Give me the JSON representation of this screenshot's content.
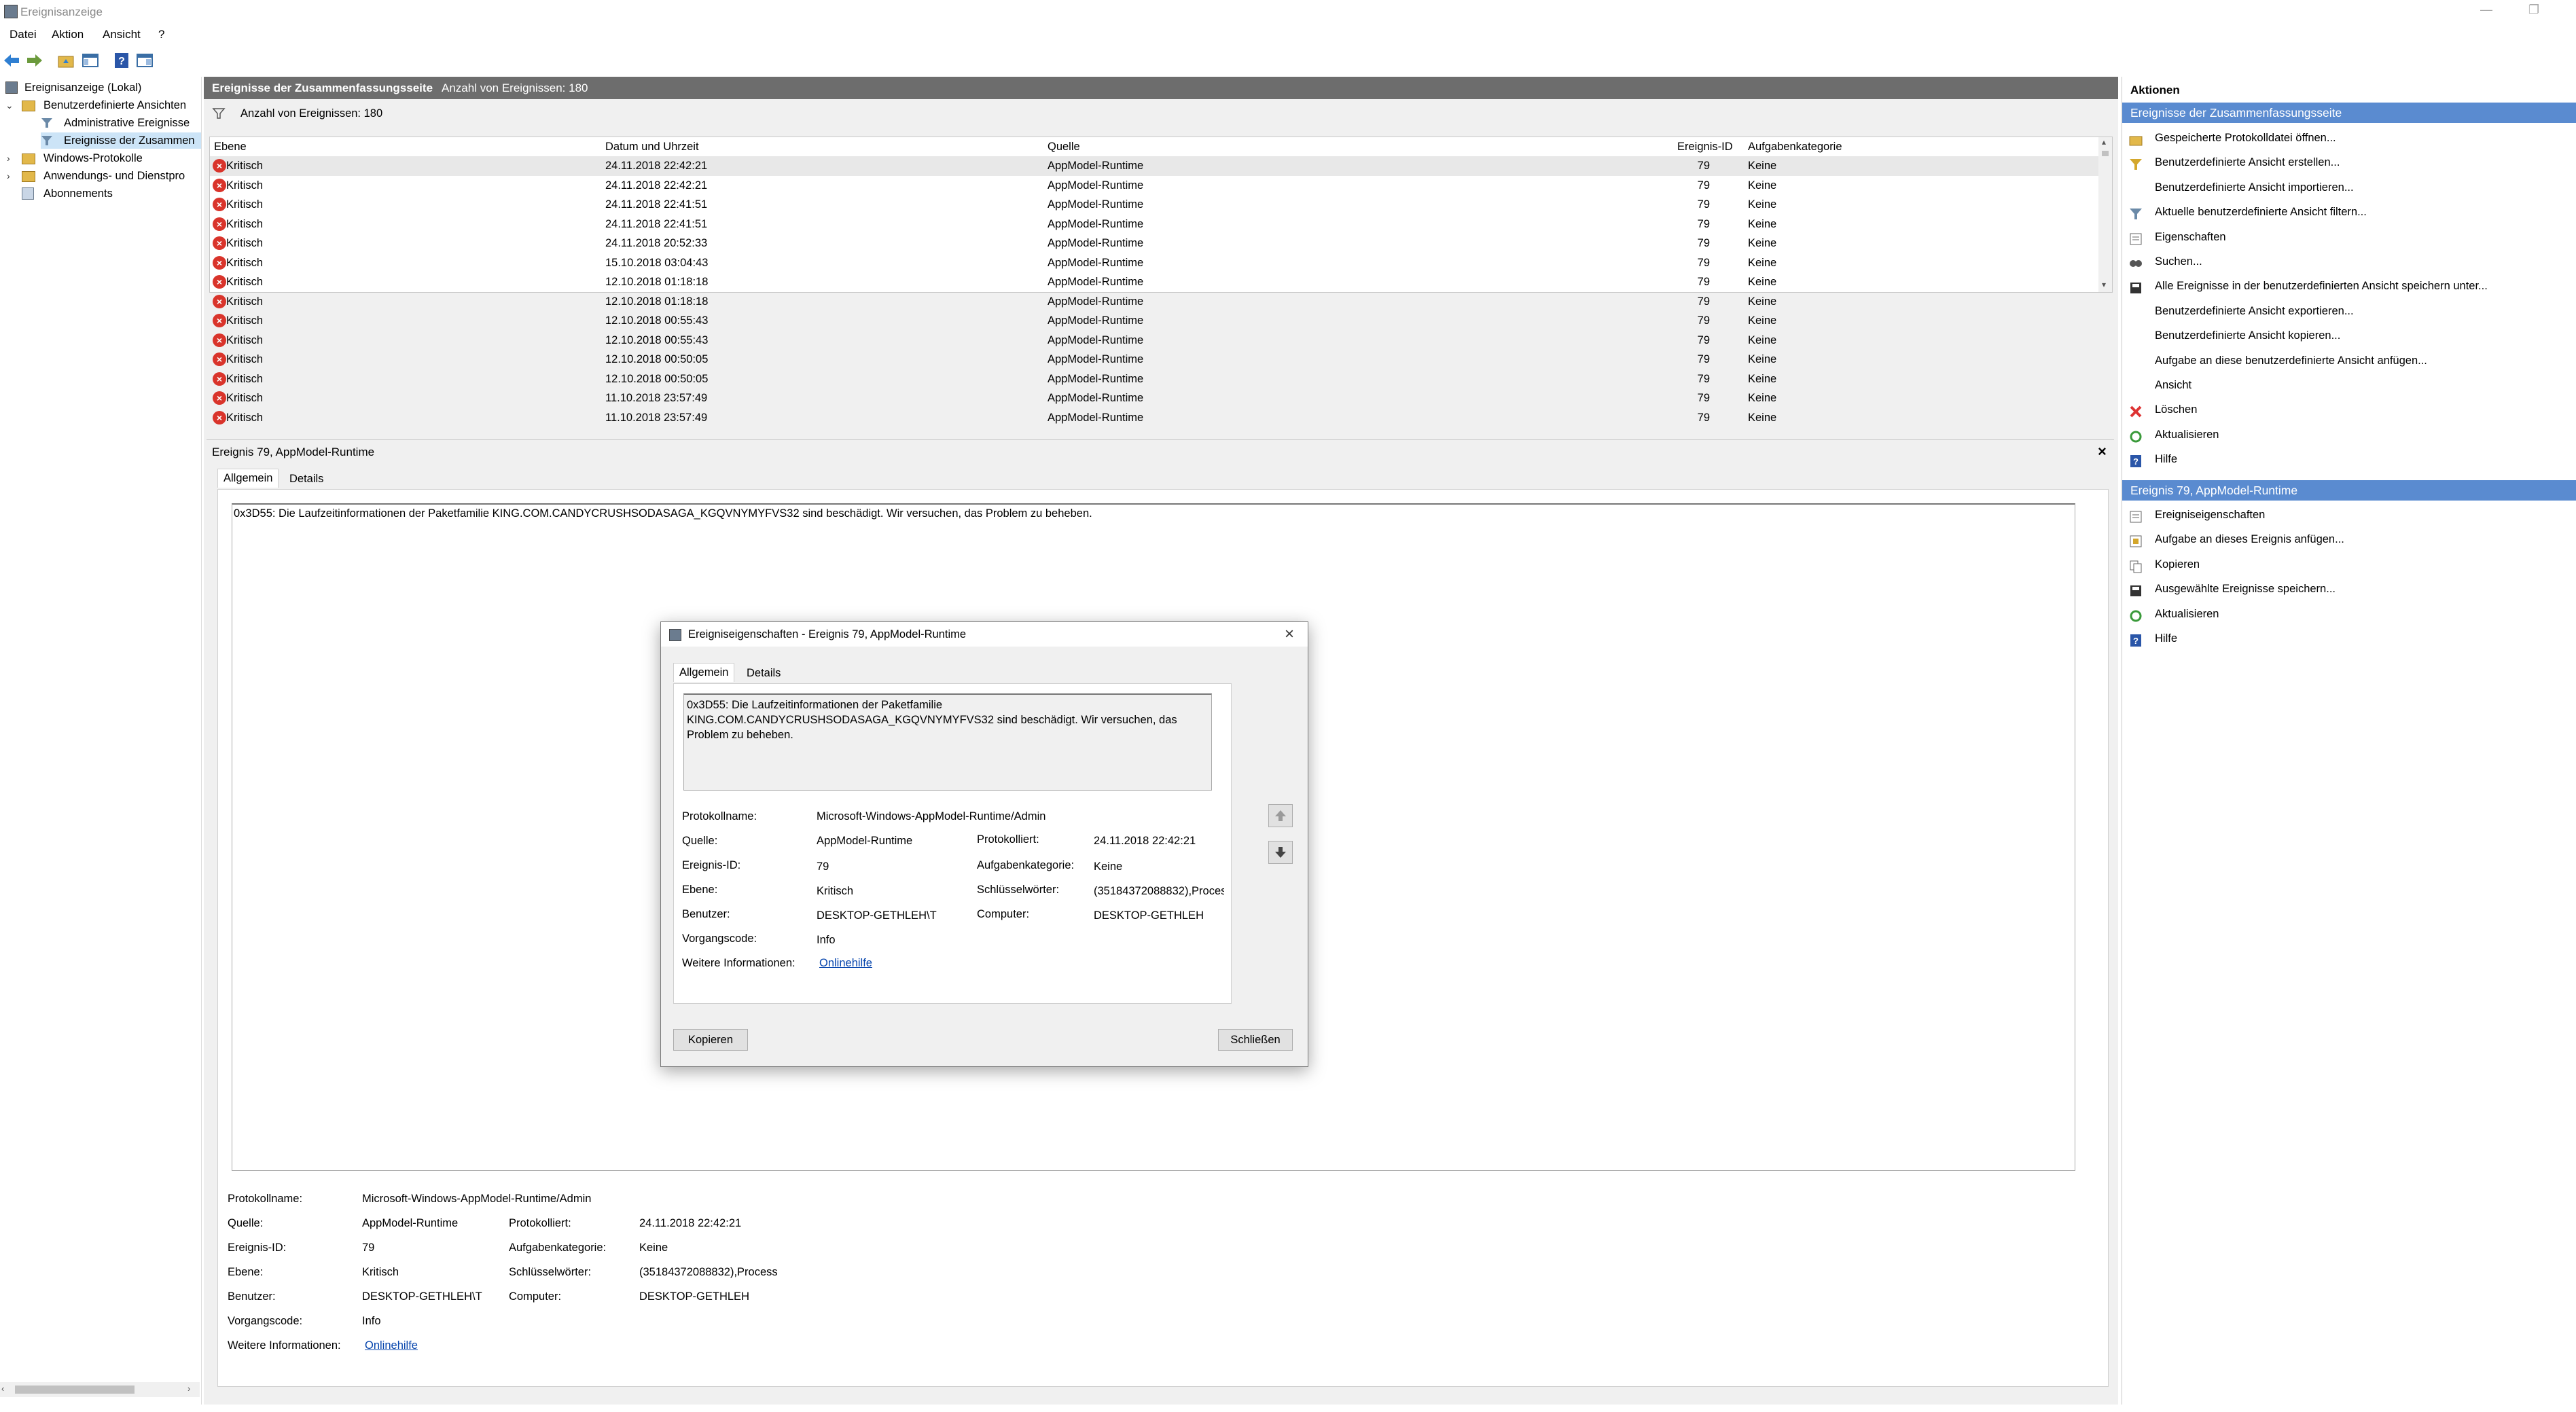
{
  "window": {
    "title": "Ereignisanzeige"
  },
  "menu": [
    "Datei",
    "Aktion",
    "Ansicht",
    "?"
  ],
  "tree": {
    "items": [
      "Ereignisanzeige (Lokal)",
      "Benutzerdefinierte Ansichten",
      "Administrative Ereignisse",
      "Ereignisse der Zusammen",
      "Windows-Protokolle",
      "Anwendungs- und Dienstpro",
      "Abonnements"
    ]
  },
  "summary": {
    "header_title": "Ereignisse der Zusammenfassungsseite",
    "header_count": "Anzahl von Ereignissen: 180",
    "filter_count": "Anzahl von Ereignissen: 180"
  },
  "table": {
    "columns": [
      "Ebene",
      "Datum und Uhrzeit",
      "Quelle",
      "Ereignis-ID",
      "Aufgabenkategorie"
    ],
    "rows": [
      [
        "Kritisch",
        "24.11.2018 22:42:21",
        "AppModel-Runtime",
        "79",
        "Keine"
      ],
      [
        "Kritisch",
        "24.11.2018 22:42:21",
        "AppModel-Runtime",
        "79",
        "Keine"
      ],
      [
        "Kritisch",
        "24.11.2018 22:41:51",
        "AppModel-Runtime",
        "79",
        "Keine"
      ],
      [
        "Kritisch",
        "24.11.2018 22:41:51",
        "AppModel-Runtime",
        "79",
        "Keine"
      ],
      [
        "Kritisch",
        "24.11.2018 20:52:33",
        "AppModel-Runtime",
        "79",
        "Keine"
      ],
      [
        "Kritisch",
        "15.10.2018 03:04:43",
        "AppModel-Runtime",
        "79",
        "Keine"
      ],
      [
        "Kritisch",
        "12.10.2018 01:18:18",
        "AppModel-Runtime",
        "79",
        "Keine"
      ],
      [
        "Kritisch",
        "12.10.2018 01:18:18",
        "AppModel-Runtime",
        "79",
        "Keine"
      ],
      [
        "Kritisch",
        "12.10.2018 00:55:43",
        "AppModel-Runtime",
        "79",
        "Keine"
      ],
      [
        "Kritisch",
        "12.10.2018 00:55:43",
        "AppModel-Runtime",
        "79",
        "Keine"
      ],
      [
        "Kritisch",
        "12.10.2018 00:50:05",
        "AppModel-Runtime",
        "79",
        "Keine"
      ],
      [
        "Kritisch",
        "12.10.2018 00:50:05",
        "AppModel-Runtime",
        "79",
        "Keine"
      ],
      [
        "Kritisch",
        "11.10.2018 23:57:49",
        "AppModel-Runtime",
        "79",
        "Keine"
      ],
      [
        "Kritisch",
        "11.10.2018 23:57:49",
        "AppModel-Runtime",
        "79",
        "Keine"
      ]
    ]
  },
  "detail": {
    "title": "Ereignis 79, AppModel-Runtime",
    "tabs": [
      "Allgemein",
      "Details"
    ],
    "message": "0x3D55: Die Laufzeitinformationen der Paketfamilie KING.COM.CANDYCRUSHSODASAGA_KGQVNYMYFVS32 sind beschädigt. Wir versuchen, das Problem zu beheben.",
    "labels": {
      "protokollname": "Protokollname:",
      "quelle": "Quelle:",
      "ereignis_id": "Ereignis-ID:",
      "ebene": "Ebene:",
      "benutzer": "Benutzer:",
      "vorgangscode": "Vorgangscode:",
      "weitere": "Weitere Informationen:",
      "protokolliert": "Protokolliert:",
      "aufgabenkategorie": "Aufgabenkategorie:",
      "schluesselwoerter": "Schlüsselwörter:",
      "computer": "Computer:"
    },
    "values": {
      "protokollname": "Microsoft-Windows-AppModel-Runtime/Admin",
      "quelle": "AppModel-Runtime",
      "ereignis_id": "79",
      "ebene": "Kritisch",
      "benutzer": "DESKTOP-GETHLEH\\T",
      "vorgangscode": "Info",
      "weitere": "Onlinehilfe",
      "protokolliert": "24.11.2018 22:42:21",
      "aufgabenkategorie": "Keine",
      "schluesselwoerter": "(35184372088832),Process",
      "computer": "DESKTOP-GETHLEH"
    }
  },
  "dialog": {
    "title": "Ereigniseigenschaften - Ereignis 79, AppModel-Runtime",
    "tabs": [
      "Allgemein",
      "Details"
    ],
    "message": "0x3D55: Die Laufzeitinformationen der Paketfamilie KING.COM.CANDYCRUSHSODASAGA_KGQVNYMYFVS32 sind beschädigt. Wir versuchen, das Problem zu beheben.",
    "copy_button": "Kopieren",
    "close_button": "Schließen"
  },
  "actions": {
    "title": "Aktionen",
    "section1": "Ereignisse der Zusammenfassungsseite",
    "items1": [
      "Gespeicherte Protokolldatei öffnen...",
      "Benutzerdefinierte Ansicht erstellen...",
      "Benutzerdefinierte Ansicht importieren...",
      "Aktuelle benutzerdefinierte Ansicht filtern...",
      "Eigenschaften",
      "Suchen...",
      "Alle Ereignisse in der benutzerdefinierten Ansicht speichern unter...",
      "Benutzerdefinierte Ansicht exportieren...",
      "Benutzerdefinierte Ansicht kopieren...",
      "Aufgabe an diese benutzerdefinierte Ansicht anfügen...",
      "Ansicht",
      "Löschen",
      "Aktualisieren",
      "Hilfe"
    ],
    "section2": "Ereignis 79, AppModel-Runtime",
    "items2": [
      "Ereigniseigenschaften",
      "Aufgabe an dieses Ereignis anfügen...",
      "Kopieren",
      "Ausgewählte Ereignisse speichern...",
      "Aktualisieren",
      "Hilfe"
    ]
  }
}
